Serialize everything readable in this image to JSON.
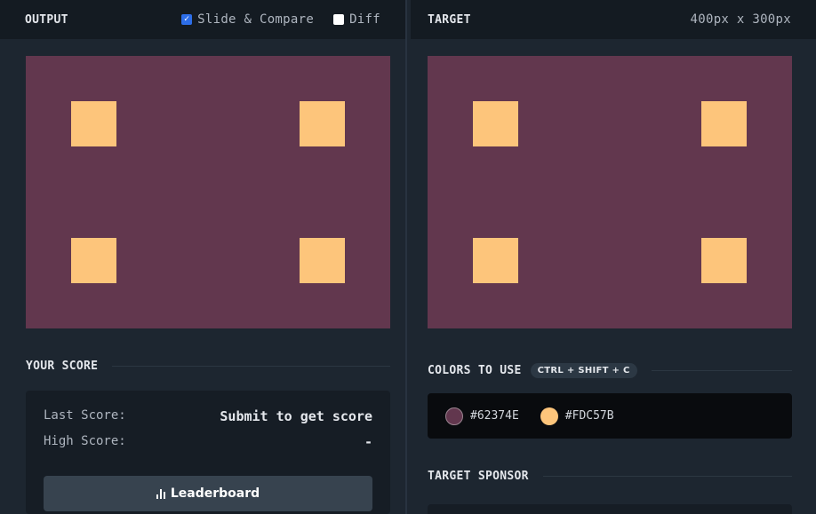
{
  "output": {
    "title": "OUTPUT",
    "slide_compare_label": "Slide & Compare",
    "slide_compare_checked": true,
    "diff_label": "Diff",
    "diff_checked": false
  },
  "target": {
    "title": "TARGET",
    "dimensions": "400px x 300px"
  },
  "canvas_colors": {
    "background": "#62374E",
    "square": "#FDC57B"
  },
  "score": {
    "section_title": "YOUR SCORE",
    "last_score_label": "Last Score:",
    "last_score_value": "Submit to get score",
    "high_score_label": "High Score:",
    "high_score_value": "-",
    "leaderboard_label": "Leaderboard",
    "leaderboard_icon": "bar-chart-icon"
  },
  "colors_to_use": {
    "section_title": "COLORS TO USE",
    "shortcut": "CTRL + SHIFT + C",
    "colors": [
      {
        "hex": "#62374E",
        "label": "#62374E"
      },
      {
        "hex": "#FDC57B",
        "label": "#FDC57B"
      }
    ]
  },
  "sponsor": {
    "section_title": "TARGET SPONSOR"
  }
}
